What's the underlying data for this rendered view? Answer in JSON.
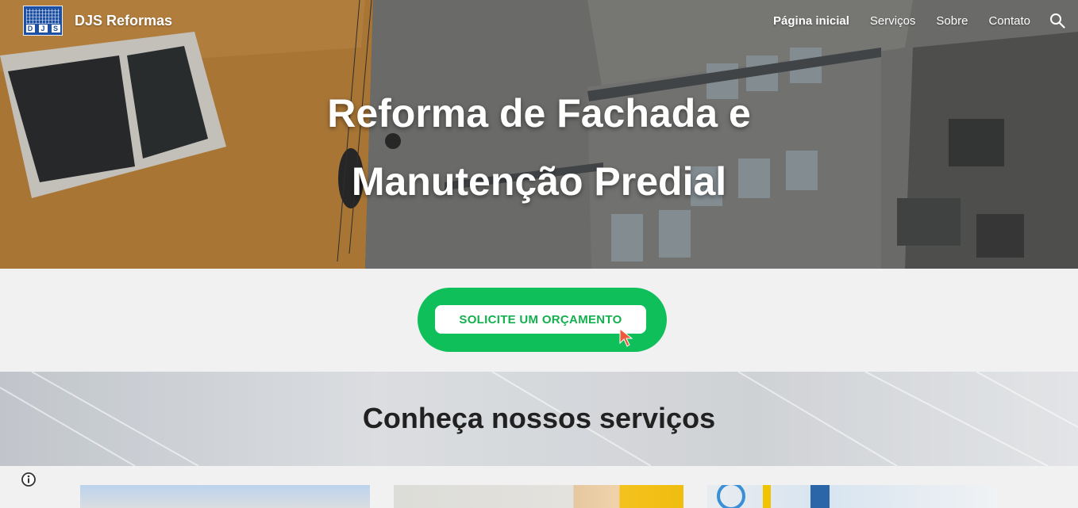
{
  "brand": {
    "logo_letters": [
      "D",
      "J",
      "S"
    ],
    "site_name": "DJS Reformas"
  },
  "nav": {
    "items": [
      {
        "label": "Página inicial",
        "active": true
      },
      {
        "label": "Serviços",
        "active": false
      },
      {
        "label": "Sobre",
        "active": false
      },
      {
        "label": "Contato",
        "active": false
      }
    ],
    "search_icon": "search-icon"
  },
  "hero": {
    "title_line1": "Reforma de Fachada e",
    "title_line2": "Manutenção Predial"
  },
  "cta": {
    "label": "SOLICITE UM ORÇAMENTO",
    "outer_color": "#0fbf5a",
    "text_color": "#14b04f",
    "cursor_icon": "cursor-arrow-icon"
  },
  "services": {
    "title": "Conheça nossos serviços"
  },
  "footer_badge": {
    "info_icon": "info-icon"
  }
}
